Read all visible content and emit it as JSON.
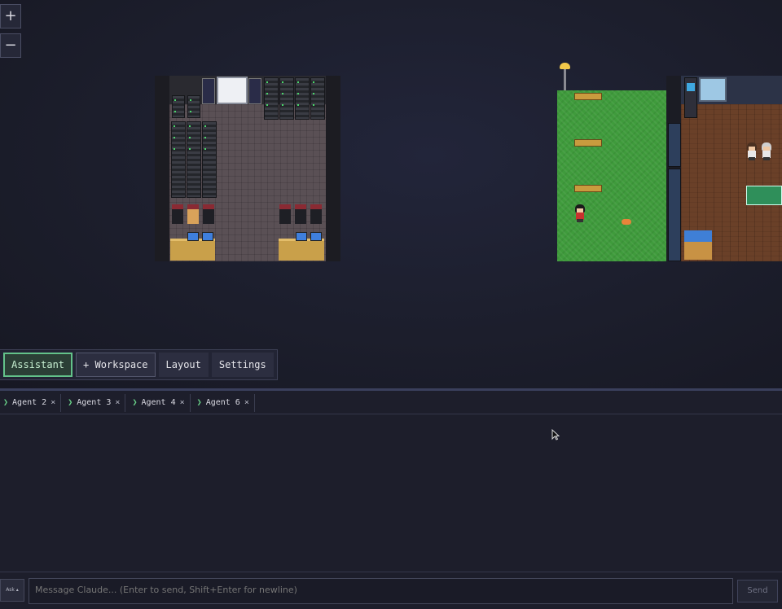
{
  "zoom": {
    "in_label": "+",
    "out_label": "−"
  },
  "toolbar": {
    "tabs": [
      {
        "label": "Assistant",
        "active": true
      },
      {
        "label": "+ Workspace",
        "active": false
      },
      {
        "label": "Layout",
        "active": false
      },
      {
        "label": "Settings",
        "active": false
      }
    ]
  },
  "agent_tabs": [
    {
      "label": "Agent 2",
      "close": "×"
    },
    {
      "label": "Agent 3",
      "close": "×"
    },
    {
      "label": "Agent 4",
      "close": "×"
    },
    {
      "label": "Agent 6",
      "close": "×"
    }
  ],
  "composer": {
    "mode_label": "Ask ▴",
    "placeholder": "Message Claude... (Enter to send, Shift+Enter for newline)",
    "send_label": "Send"
  },
  "colors": {
    "accent": "#63c28a",
    "background": "#1d1e2b",
    "grass": "#3f9b3c"
  }
}
